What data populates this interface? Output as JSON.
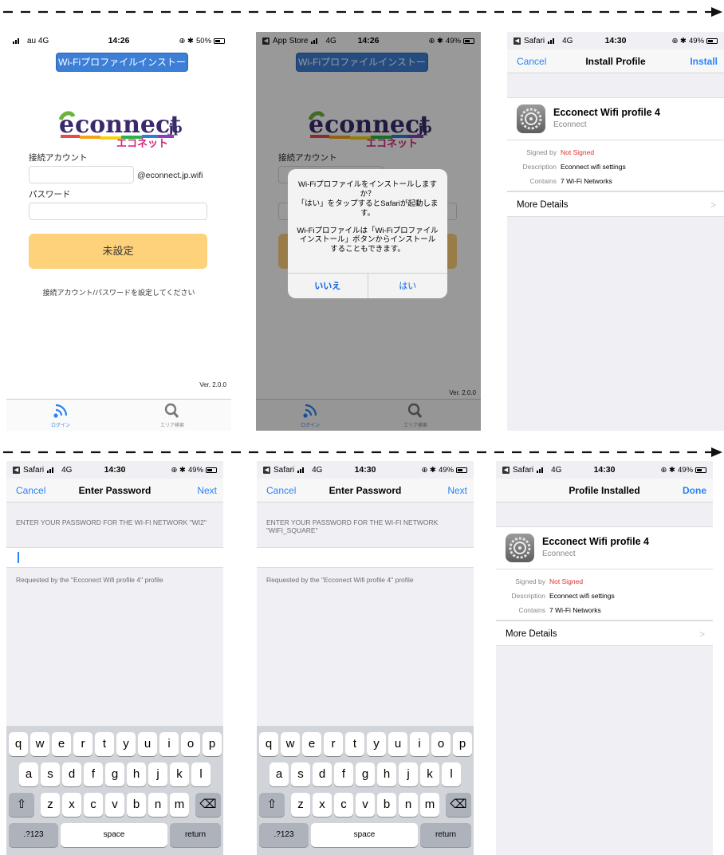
{
  "status_bars": {
    "s1": {
      "carrier": "au 4G",
      "time": "14:26",
      "battery": "50%"
    },
    "s2": {
      "carrier": "App Store",
      "network": "4G",
      "time": "14:26",
      "battery": "49%"
    },
    "s3": {
      "carrier": "Safari",
      "network": "4G",
      "time": "14:30",
      "battery": "49%"
    }
  },
  "app": {
    "title_button": "Wi-Fiプロファイルインストール",
    "account_label": "接続アカウント",
    "domain_suffix": "@econnect.jp.wifi",
    "password_label": "パスワード",
    "main_button": "未設定",
    "hint": "接続アカウント/パスワードを設定してください",
    "version": "Ver. 2.0.0",
    "tabs": [
      "ログイン",
      "エリア検索"
    ]
  },
  "alert": {
    "line1": "Wi-Fiプロファイルをインストールしますか？",
    "line2": "「はい」をタップするとSafariが起動します。",
    "line3": "Wi-Fiプロファイルは「Wi-Fiプロファイルインストール」ボタンからインストールすることもできます。",
    "no": "いいえ",
    "yes": "はい"
  },
  "install": {
    "cancel": "Cancel",
    "title": "Install Profile",
    "action": "Install"
  },
  "profile": {
    "name": "Ecconect Wifi profile 4",
    "org": "Econnect",
    "signed_by_key": "Signed by",
    "signed_by_val": "Not Signed",
    "description_key": "Description",
    "description_val": "Econnect wifi settings",
    "contains_key": "Contains",
    "contains_val": "7 Wi-Fi Networks",
    "more_details": "More Details"
  },
  "password": {
    "cancel": "Cancel",
    "title": "Enter Password",
    "next": "Next",
    "prompt1": "ENTER YOUR PASSWORD FOR THE WI-FI NETWORK \"WI2\"",
    "prompt2": "ENTER YOUR PASSWORD FOR THE WI-FI NETWORK \"WIFI_SQUARE\"",
    "requested": "Requested by the \"Ecconect Wifi profile 4\" profile"
  },
  "installed": {
    "title": "Profile Installed",
    "done": "Done"
  },
  "keyboard": {
    "row1": [
      "q",
      "w",
      "e",
      "r",
      "t",
      "y",
      "u",
      "i",
      "o",
      "p"
    ],
    "row2": [
      "a",
      "s",
      "d",
      "f",
      "g",
      "h",
      "j",
      "k",
      "l"
    ],
    "row3": [
      "z",
      "x",
      "c",
      "v",
      "b",
      "n",
      "m"
    ],
    "shift": "⇧",
    "delete": "⌫",
    "numbers": ".?123",
    "space": "space",
    "return": "return"
  },
  "colors": {
    "accent": "#2b82f5",
    "orange": "#fed17b",
    "app_blue": "#3d7fd7",
    "red": "#e03030"
  }
}
